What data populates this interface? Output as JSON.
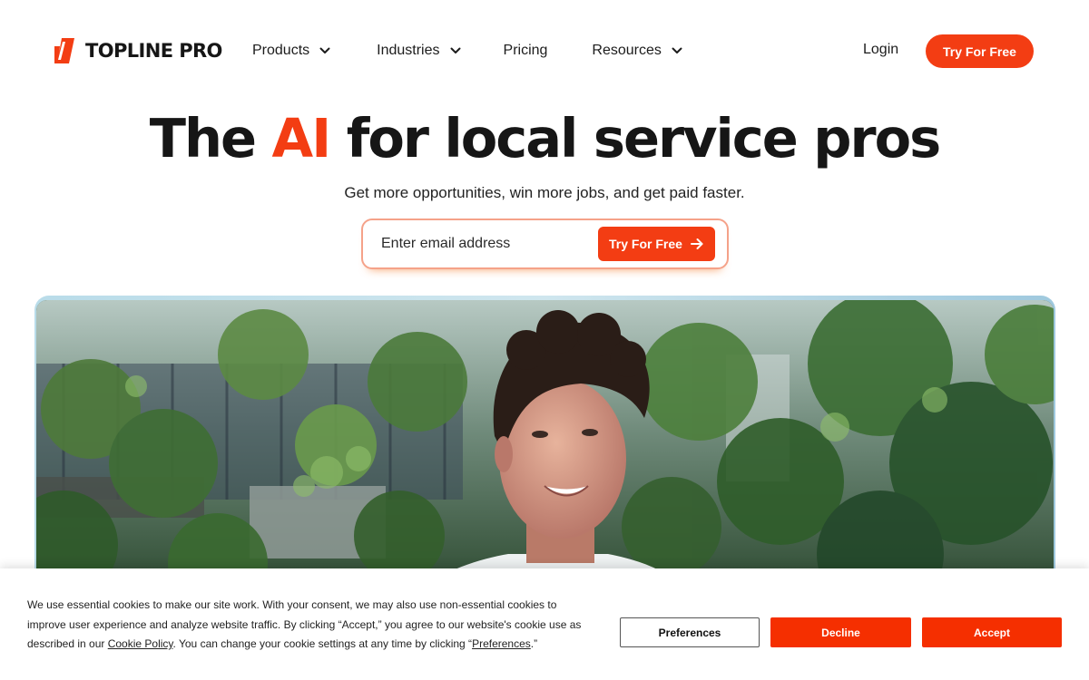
{
  "brand": {
    "name": "TOPLINE PRO",
    "accent_color": "#f33d13"
  },
  "nav": {
    "items": [
      {
        "label": "Products",
        "has_dropdown": true
      },
      {
        "label": "Industries",
        "has_dropdown": true
      },
      {
        "label": "Pricing",
        "has_dropdown": false
      },
      {
        "label": "Resources",
        "has_dropdown": true
      }
    ],
    "login_label": "Login",
    "cta_label": "Try For Free"
  },
  "hero": {
    "title_before": "The ",
    "title_accent": "AI",
    "title_after": " for local service pros",
    "subtitle": "Get more opportunities, win more jobs, and get paid faster.",
    "email_placeholder": "Enter email address",
    "cta_label": "Try For Free",
    "cta_icon": "arrow-right-icon"
  },
  "media": {
    "icon": "hero-photo"
  },
  "cookie_banner": {
    "text_part1": "We use essential cookies to make our site work. With your consent, we may also use non-essential cookies to improve user experience and analyze website traffic. By clicking “Accept,” you agree to our website's cookie use as described in our ",
    "cookie_policy_link": "Cookie Policy",
    "text_part2": ". You can change your cookie settings at any time by clicking “",
    "preferences_link": "Preferences",
    "text_part3": ".”",
    "preferences_button": "Preferences",
    "decline_button": "Decline",
    "accept_button": "Accept",
    "button_color": "#f52f00"
  }
}
